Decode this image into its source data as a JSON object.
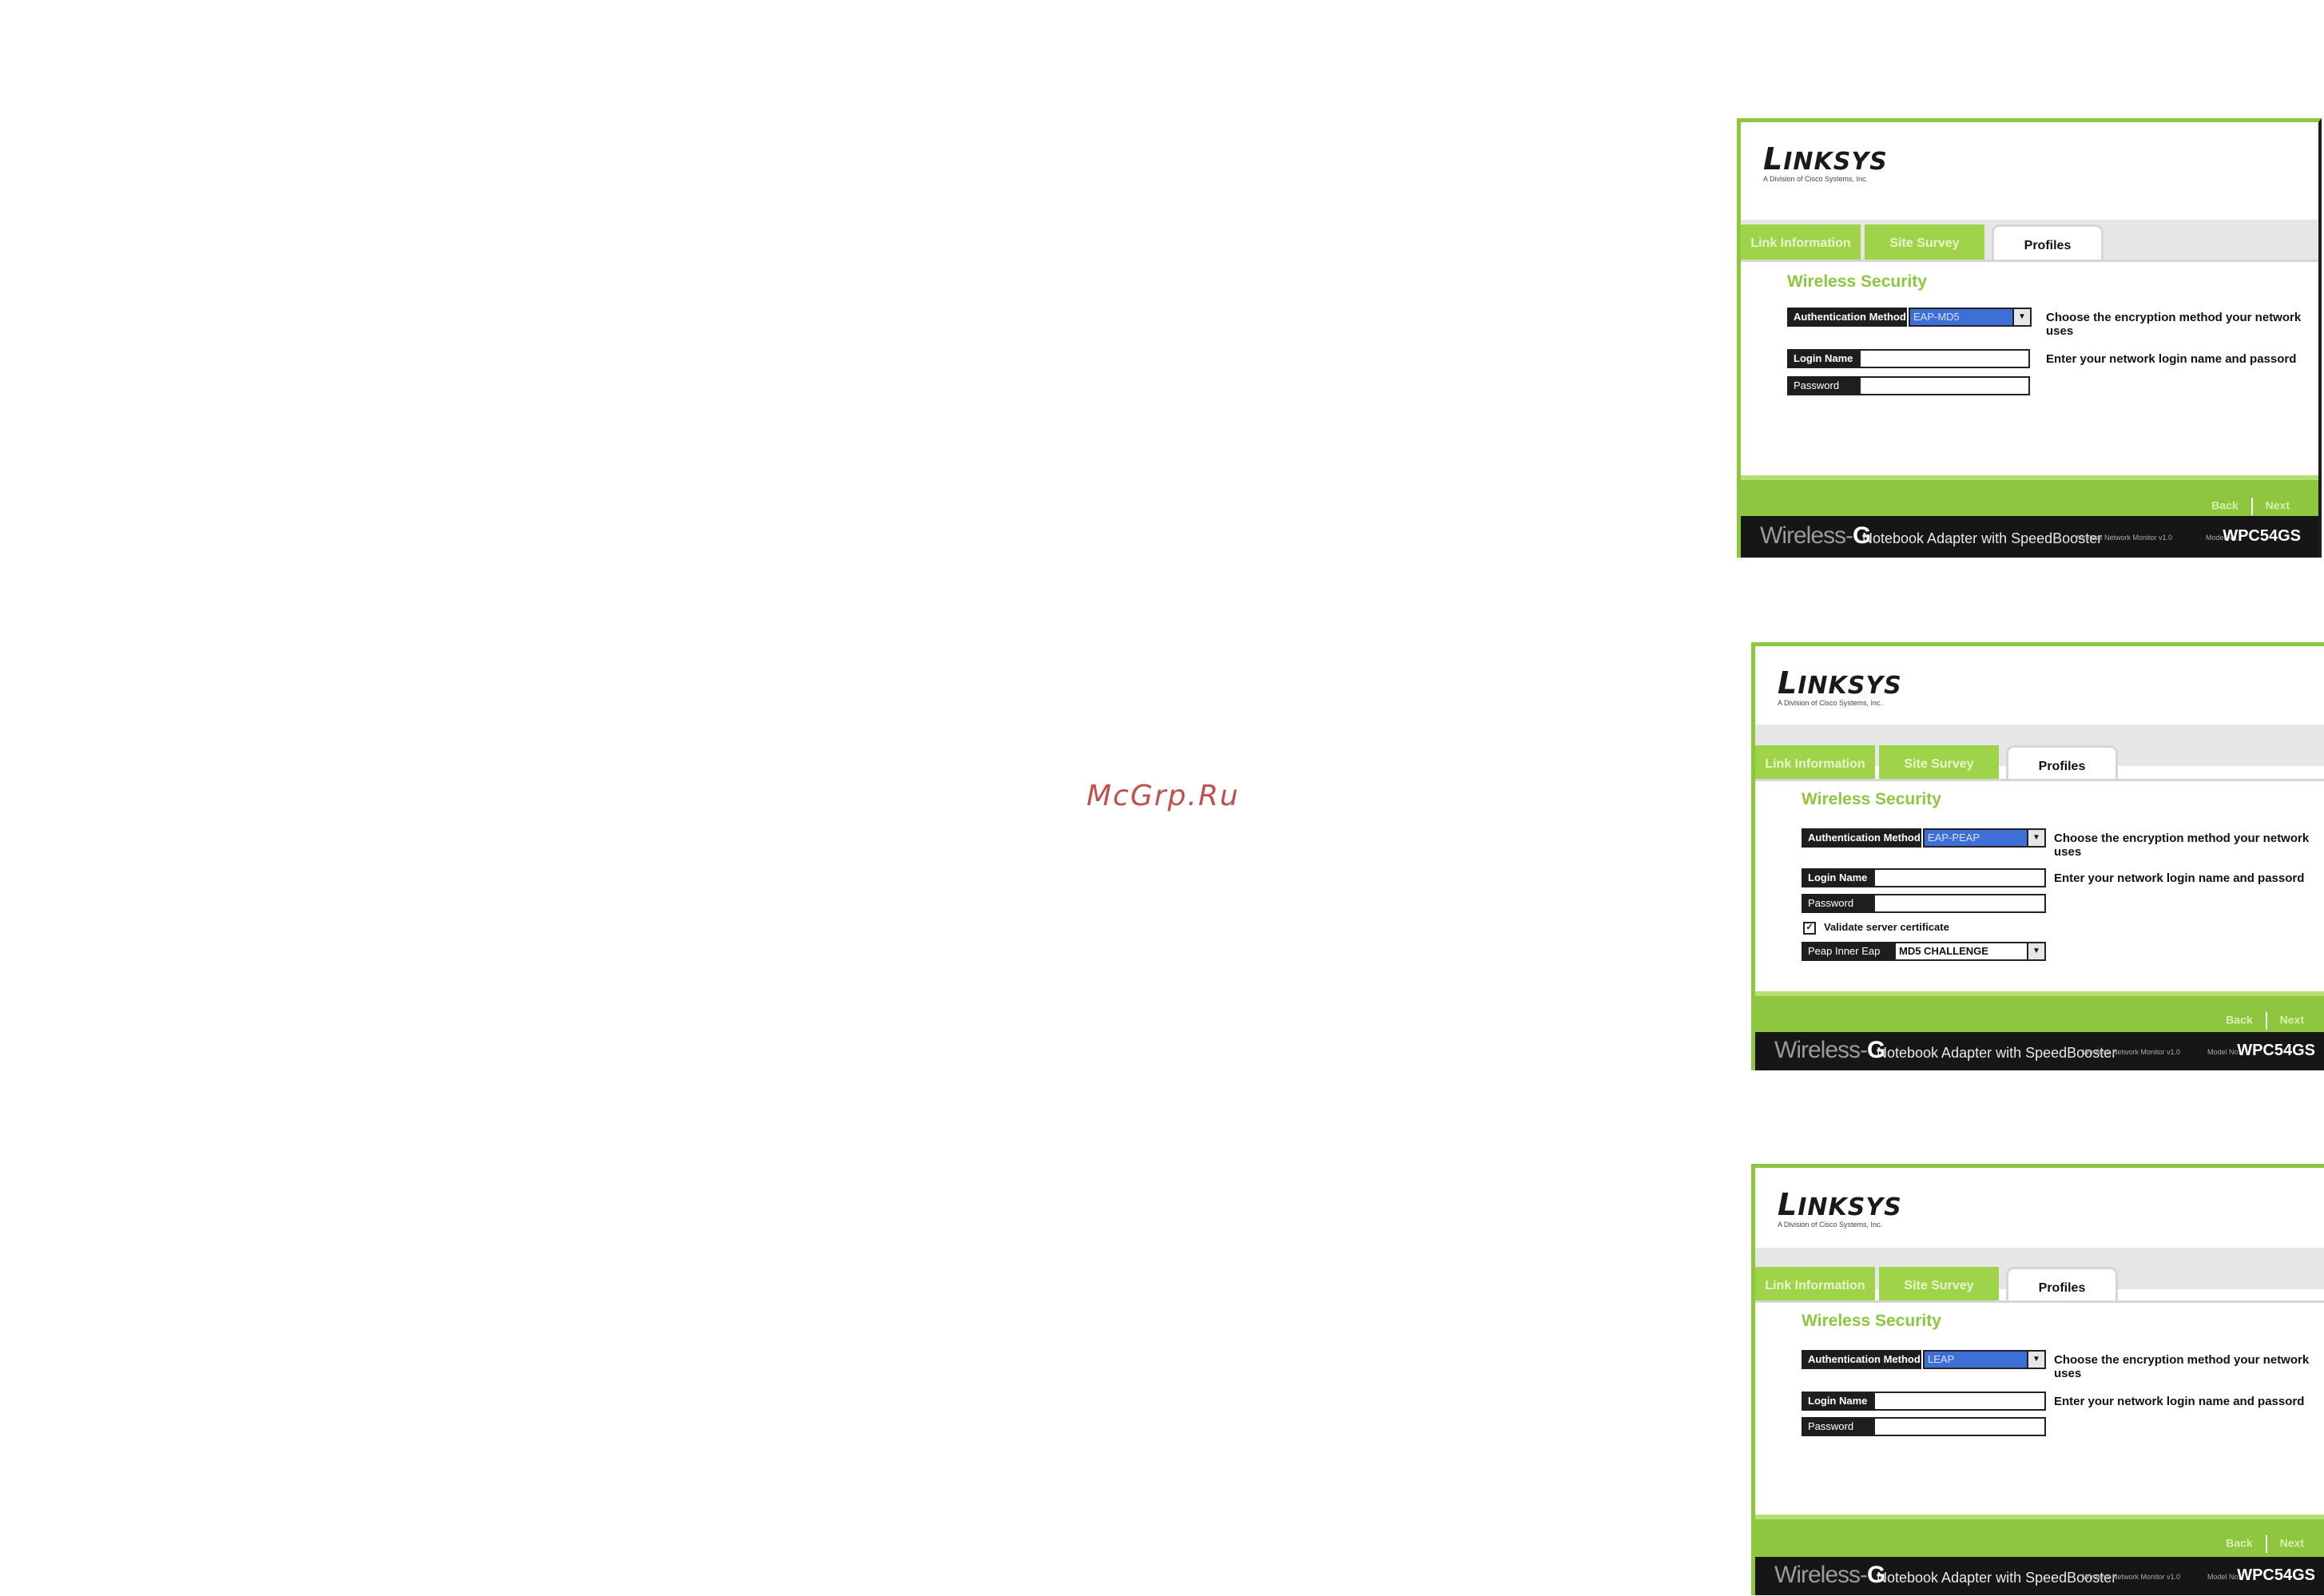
{
  "watermark": "McGrp.Ru",
  "brand": {
    "logo_first": "L",
    "logo_rest": "INKSYS",
    "logo_sub": "A Division of Cisco Systems, Inc.",
    "product_wireless": "Wireless-",
    "product_g": "G",
    "product_desc": "Notebook Adapter with SpeedBooster",
    "monitor": "Wireless Network Monitor v1.0",
    "model_label": "Model No.",
    "model": "WPC54GS"
  },
  "tabs": {
    "link_information": "Link Information",
    "site_survey": "Site Survey",
    "profiles": "Profiles"
  },
  "common": {
    "section_title": "Wireless Security",
    "auth_label": "Authentication Method",
    "auth_hint": "Choose the encryption method your network uses",
    "login_label": "Login Name",
    "password_label": "Password",
    "login_hint": "Enter your network login name and passord",
    "back": "Back",
    "next": "Next"
  },
  "screens": [
    {
      "auth_value": "EAP-MD5"
    },
    {
      "auth_value": "EAP-PEAP",
      "validate_label": "Validate server certificate",
      "validate_checked": "✓",
      "inner_eap_label": "Peap Inner Eap",
      "inner_eap_value": "MD5 CHALLENGE"
    },
    {
      "auth_value": "LEAP"
    }
  ],
  "colors": {
    "accent_green": "#8ec63f",
    "selection_blue": "#3d6fd6",
    "footer_black": "#161616"
  },
  "icons": {
    "dropdown": "▼",
    "checkbox": "✓"
  }
}
